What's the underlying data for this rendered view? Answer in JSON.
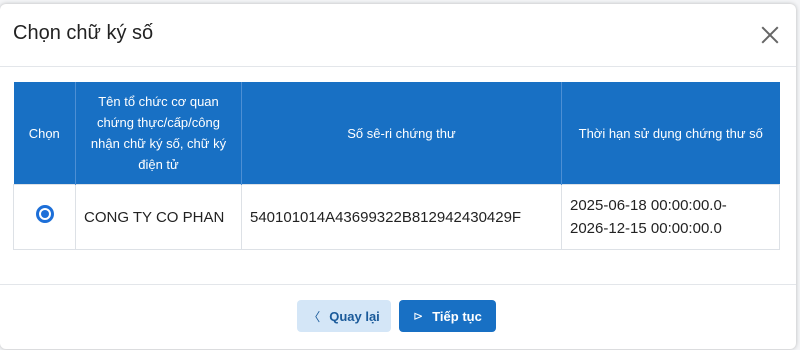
{
  "dialog": {
    "title": "Chọn chữ ký số",
    "close_icon": "close-icon"
  },
  "table": {
    "headers": [
      "Chọn",
      "Tên tổ chức cơ quan chứng thực/cấp/công nhận chữ ký số, chữ ký điện tử",
      "Số sê-ri chứng thư",
      "Thời hạn sử dụng chứng thư số"
    ],
    "rows": [
      {
        "selected": true,
        "org": "CONG TY CO PHAN",
        "serial": "540101014A43699322B812942430429F",
        "validity_from": "2025-06-18 00:00:00.0-",
        "validity_to": "2026-12-15 00:00:00.0"
      }
    ]
  },
  "footer": {
    "back_label": "Quay lại",
    "back_icon": "chevron-left-icon",
    "next_label": "Tiếp tục",
    "next_icon": "arrow-next-icon"
  },
  "colors": {
    "header_bg": "#1870c4",
    "radio": "#1d6fd8",
    "back_button_bg": "#d4e6f7"
  }
}
